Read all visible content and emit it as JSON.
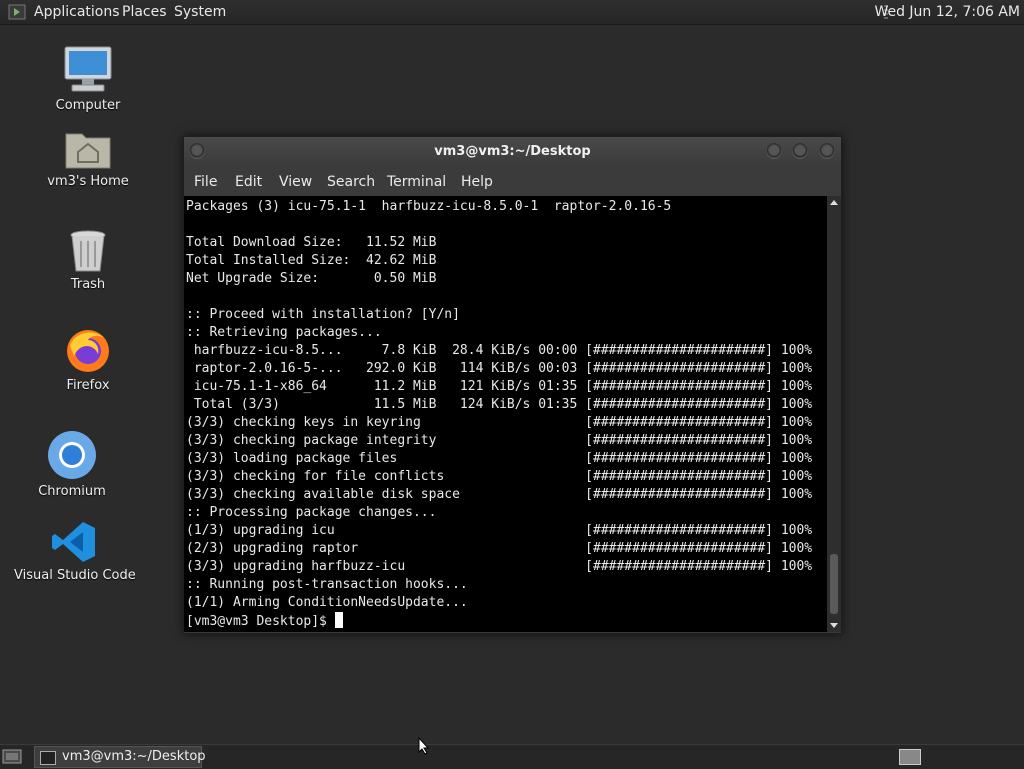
{
  "top_panel": {
    "menus": [
      "Applications",
      "Places",
      "System"
    ],
    "clock": "Wed Jun 12,  7:06 AM"
  },
  "desktop_icons": [
    {
      "label": "Computer",
      "icon": "computer-icon"
    },
    {
      "label": "vm3's Home",
      "icon": "home-folder-icon"
    },
    {
      "label": "Trash",
      "icon": "trash-icon"
    },
    {
      "label": "Firefox",
      "icon": "firefox-icon"
    },
    {
      "label": "Chromium",
      "icon": "chromium-icon"
    },
    {
      "label": "Visual Studio Code",
      "icon": "vscode-icon"
    }
  ],
  "terminal": {
    "title": "vm3@vm3:~/Desktop",
    "menu": [
      "File",
      "Edit",
      "View",
      "Search",
      "Terminal",
      "Help"
    ],
    "lines": [
      "Packages (3) icu-75.1-1  harfbuzz-icu-8.5.0-1  raptor-2.0.16-5",
      "",
      "Total Download Size:   11.52 MiB",
      "Total Installed Size:  42.62 MiB",
      "Net Upgrade Size:       0.50 MiB",
      "",
      ":: Proceed with installation? [Y/n]",
      ":: Retrieving packages...",
      " harfbuzz-icu-8.5...     7.8 KiB  28.4 KiB/s 00:00 [######################] 100%",
      " raptor-2.0.16-5-...   292.0 KiB   114 KiB/s 00:03 [######################] 100%",
      " icu-75.1-1-x86_64      11.2 MiB   121 KiB/s 01:35 [######################] 100%",
      " Total (3/3)            11.5 MiB   124 KiB/s 01:35 [######################] 100%",
      "(3/3) checking keys in keyring                     [######################] 100%",
      "(3/3) checking package integrity                   [######################] 100%",
      "(3/3) loading package files                        [######################] 100%",
      "(3/3) checking for file conflicts                  [######################] 100%",
      "(3/3) checking available disk space                [######################] 100%",
      ":: Processing package changes...",
      "(1/3) upgrading icu                                [######################] 100%",
      "(2/3) upgrading raptor                             [######################] 100%",
      "(3/3) upgrading harfbuzz-icu                       [######################] 100%",
      ":: Running post-transaction hooks...",
      "(1/1) Arming ConditionNeedsUpdate..."
    ],
    "prompt": "[vm3@vm3 Desktop]$ "
  },
  "taskbar": {
    "task_label": "vm3@vm3:~/Desktop"
  }
}
